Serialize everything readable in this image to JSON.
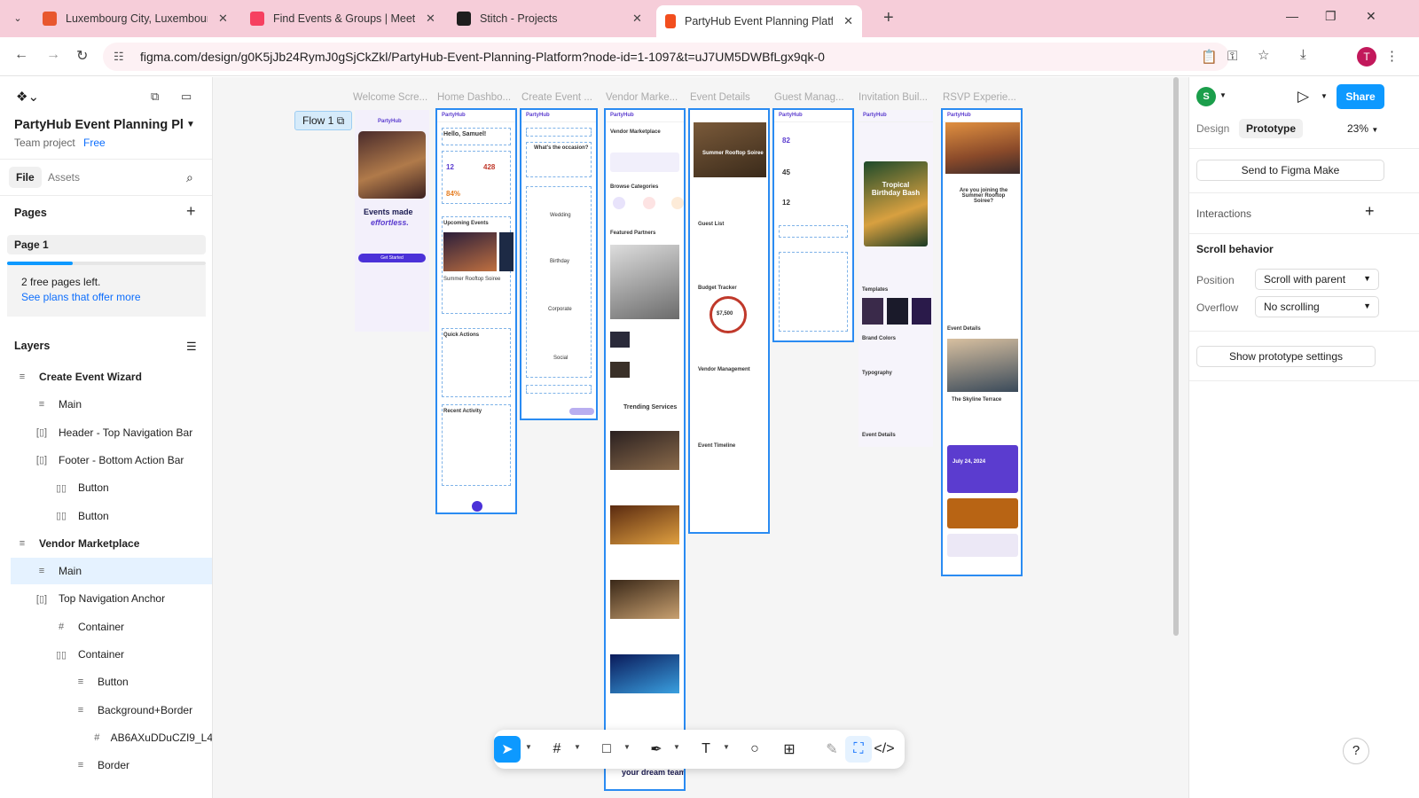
{
  "browser": {
    "tabs": [
      {
        "title": "Luxembourg City, Luxembourg",
        "color": "#e8572e"
      },
      {
        "title": "Find Events & Groups | Meetup",
        "color": "#f64060"
      },
      {
        "title": "Stitch - Projects",
        "color": "#1e1e1e"
      },
      {
        "title": "PartyHub Event Planning Platfo",
        "color": "#f24e1e"
      }
    ],
    "url": "figma.com/design/g0K5jJb24RymJ0gSjCkZkl/PartyHub-Event-Planning-Platform?node-id=1-1097&t=uJ7UM5DWBfLgx9qk-0",
    "profile_initial": "T"
  },
  "file": {
    "title": "PartyHub Event Planning Pl...",
    "team": "Team project",
    "plan": "Free"
  },
  "left_tabs": [
    "File",
    "Assets"
  ],
  "pages": {
    "heading": "Pages",
    "items": [
      "Page 1"
    ],
    "free_pages_note": "2 free pages left.",
    "plans_link": "See plans that offer more",
    "used_fraction": 0.33
  },
  "layers": {
    "heading": "Layers",
    "items": [
      {
        "label": "Create Event Wizard",
        "icon": "≡",
        "indent": 0,
        "bold": true
      },
      {
        "label": "Main",
        "icon": "≡",
        "indent": 1
      },
      {
        "label": "Header - Top Navigation Bar",
        "icon": "[▯]",
        "indent": 1
      },
      {
        "label": "Footer - Bottom Action Bar",
        "icon": "[▯]",
        "indent": 1
      },
      {
        "label": "Button",
        "icon": "▯▯",
        "indent": 2
      },
      {
        "label": "Button",
        "icon": "▯▯",
        "indent": 2
      },
      {
        "label": "Vendor Marketplace",
        "icon": "≡",
        "indent": 0,
        "bold": true
      },
      {
        "label": "Main",
        "icon": "≡",
        "indent": 1,
        "selected": true
      },
      {
        "label": "Top Navigation Anchor",
        "icon": "[▯]",
        "indent": 1
      },
      {
        "label": "Container",
        "icon": "#",
        "indent": 2
      },
      {
        "label": "Container",
        "icon": "▯▯",
        "indent": 2
      },
      {
        "label": "Button",
        "icon": "≡",
        "indent": 3
      },
      {
        "label": "Background+Border",
        "icon": "≡",
        "indent": 3
      },
      {
        "label": "AB6AXuDDuCZI9_L4",
        "icon": "#",
        "indent": 4
      },
      {
        "label": "Border",
        "icon": "≡",
        "indent": 3
      }
    ]
  },
  "canvas": {
    "flow_label": "Flow 1",
    "frames": [
      {
        "label": "Welcome Scre...",
        "brand": "PartyHub",
        "headline": "Events made",
        "headline2": "effortless.",
        "cta": "Get Started"
      },
      {
        "label": "Home Dashbo...",
        "brand": "PartyHub",
        "greeting": "Hello, Samuel!",
        "stat1": "12",
        "stat2": "428",
        "stat3": "84%",
        "section1": "Upcoming Events",
        "event": "Summer Rooftop Soiree",
        "section2": "Quick Actions",
        "section3": "Recent Activity"
      },
      {
        "label": "Create Event ...",
        "brand": "PartyHub",
        "question": "What's the occasion?",
        "opt1": "Wedding",
        "opt2": "Birthday",
        "opt3": "Corporate",
        "opt4": "Social"
      },
      {
        "label": "Vendor Marke...",
        "brand": "PartyHub",
        "title": "Vendor Marketplace",
        "sec1": "Browse Categories",
        "sec2": "Featured Partners",
        "sec3": "Trending Services",
        "footer": "your dream team?"
      },
      {
        "label": "Event Details",
        "event": "Summer Rooftop Soiree",
        "sec1": "Guest List",
        "sec2": "Budget Tracker",
        "budget": "$7,500",
        "sec3": "Vendor Management",
        "sec4": "Event Timeline"
      },
      {
        "label": "Guest Manag...",
        "brand": "PartyHub",
        "n1": "82",
        "n2": "45",
        "n3": "12"
      },
      {
        "label": "Invitation Buil...",
        "brand": "PartyHub",
        "card": "Tropical Birthday Bash",
        "sec1": "Templates",
        "sec2": "Brand Colors",
        "sec3": "Typography",
        "sec4": "Event Details"
      },
      {
        "label": "RSVP Experie...",
        "brand": "PartyHub",
        "question": "Are you joining the Summer Rooftop Soiree?",
        "sec1": "Event Details",
        "venue": "The Skyline Terrace",
        "date": "July 24, 2024"
      }
    ]
  },
  "toolbar": {
    "tools": [
      "move-tool",
      "frame-tool",
      "shape-tool",
      "pen-tool",
      "text-tool",
      "comment-tool",
      "actions-tool",
      "draw-mode",
      "design-mode",
      "dev-mode"
    ]
  },
  "right_panel": {
    "user_initial": "S",
    "share_label": "Share",
    "tabs": [
      "Design",
      "Prototype"
    ],
    "zoom": "23%",
    "send_button": "Send to Figma Make",
    "interactions": "Interactions",
    "scroll_behavior": "Scroll behavior",
    "position_label": "Position",
    "position_value": "Scroll with parent",
    "overflow_label": "Overflow",
    "overflow_value": "No scrolling",
    "show_settings": "Show prototype settings"
  },
  "colors": {
    "accent": "#0d99ff",
    "brand": "#5b3ccf",
    "selection": "#2a8bf2",
    "tabstrip": "#f6cdd9"
  }
}
